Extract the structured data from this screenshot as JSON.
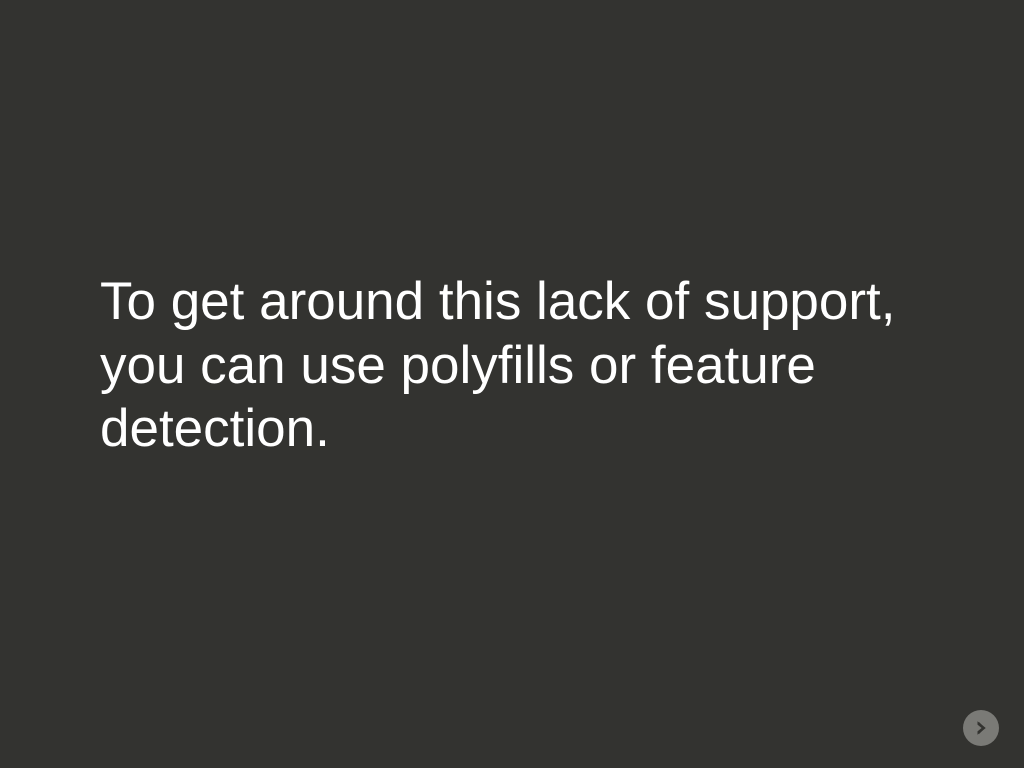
{
  "slide": {
    "body_text": "To get around this lack of support, you can use polyfills or feature detection."
  },
  "navigation": {
    "next_icon": "arrow-right-circle"
  }
}
